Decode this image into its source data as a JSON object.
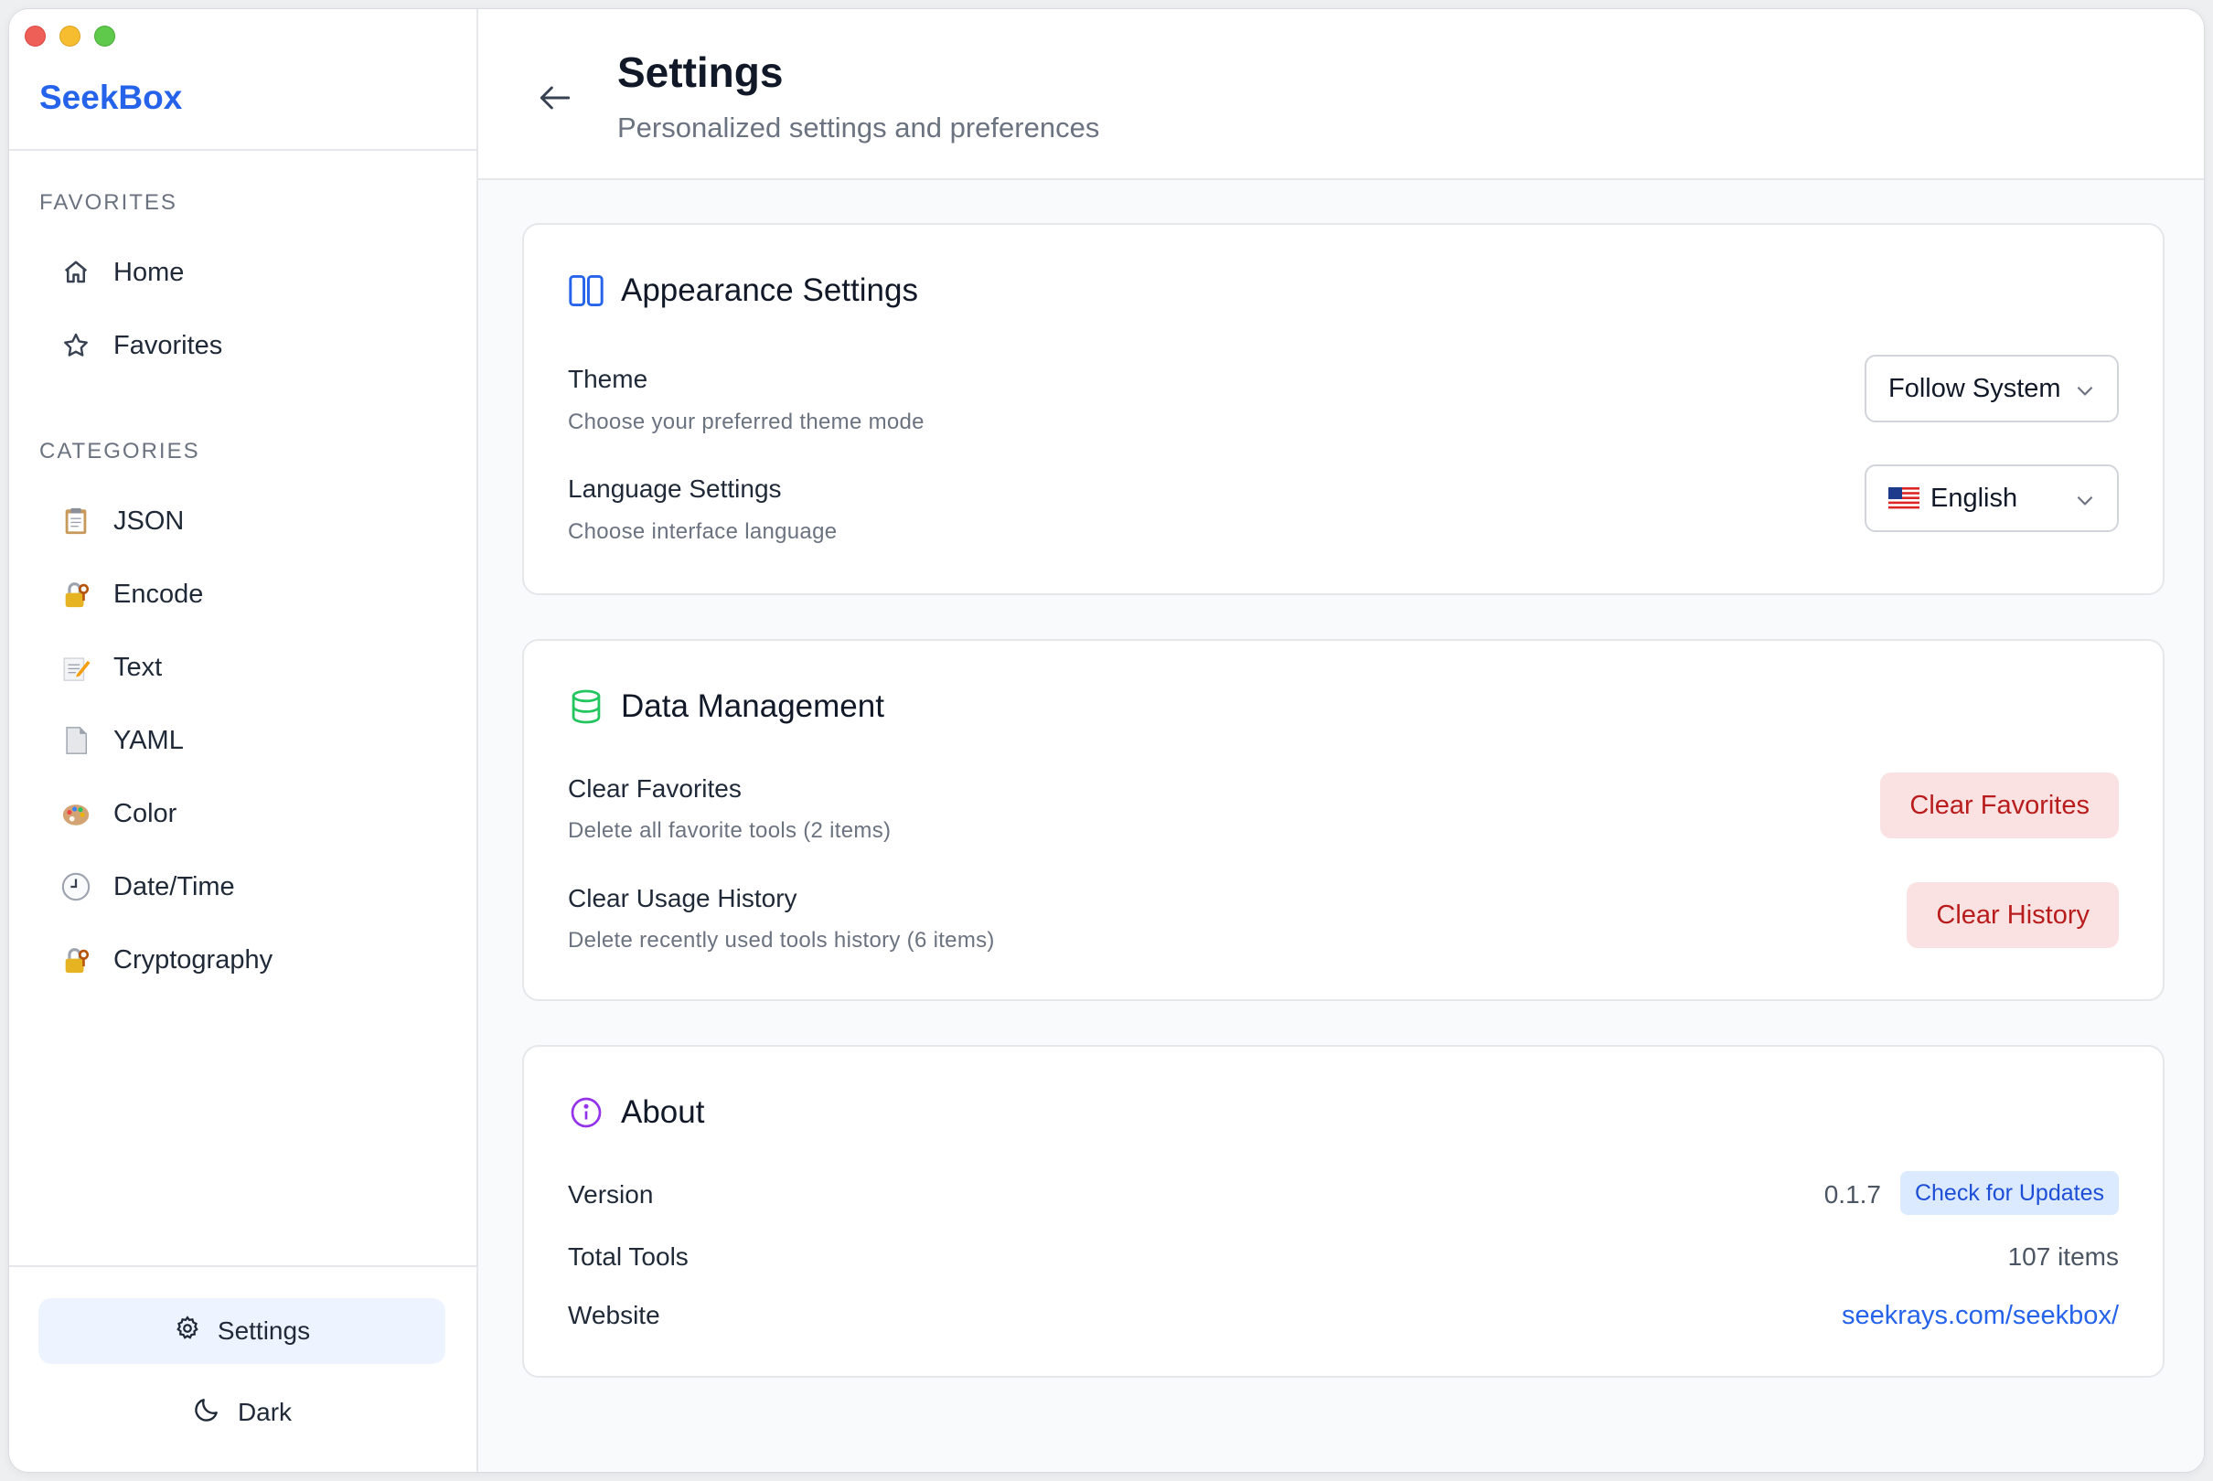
{
  "app": {
    "brand": "SeekBox"
  },
  "sidebar": {
    "favorites_label": "FAVORITES",
    "favorites": [
      {
        "label": "Home",
        "icon": "home-icon"
      },
      {
        "label": "Favorites",
        "icon": "star-icon"
      }
    ],
    "categories_label": "CATEGORIES",
    "categories": [
      {
        "label": "JSON",
        "icon": "clipboard-icon"
      },
      {
        "label": "Encode",
        "icon": "lock-key-icon"
      },
      {
        "label": "Text",
        "icon": "memo-icon"
      },
      {
        "label": "YAML",
        "icon": "document-icon"
      },
      {
        "label": "Color",
        "icon": "palette-icon"
      },
      {
        "label": "Date/Time",
        "icon": "clock-icon"
      },
      {
        "label": "Cryptography",
        "icon": "lock-key-icon"
      }
    ],
    "settings_label": "Settings",
    "dark_label": "Dark"
  },
  "header": {
    "title": "Settings",
    "subtitle": "Personalized settings and preferences"
  },
  "appearance": {
    "title": "Appearance Settings",
    "theme_label": "Theme",
    "theme_desc": "Choose your preferred theme mode",
    "theme_value": "Follow System",
    "language_label": "Language Settings",
    "language_desc": "Choose interface language",
    "language_value": "English",
    "accent": "#2563eb"
  },
  "data_management": {
    "title": "Data Management",
    "clear_favorites_label": "Clear Favorites",
    "clear_favorites_desc": "Delete all favorite tools (2 items)",
    "clear_favorites_button": "Clear Favorites",
    "clear_history_label": "Clear Usage History",
    "clear_history_desc": "Delete recently used tools history (6 items)",
    "clear_history_button": "Clear History",
    "accent": "#22c55e"
  },
  "about": {
    "title": "About",
    "version_label": "Version",
    "version_value": "0.1.7",
    "check_updates": "Check for Updates",
    "total_tools_label": "Total Tools",
    "total_tools_value": "107 items",
    "website_label": "Website",
    "website_value": "seekrays.com/seekbox/",
    "accent": "#9333ea"
  }
}
